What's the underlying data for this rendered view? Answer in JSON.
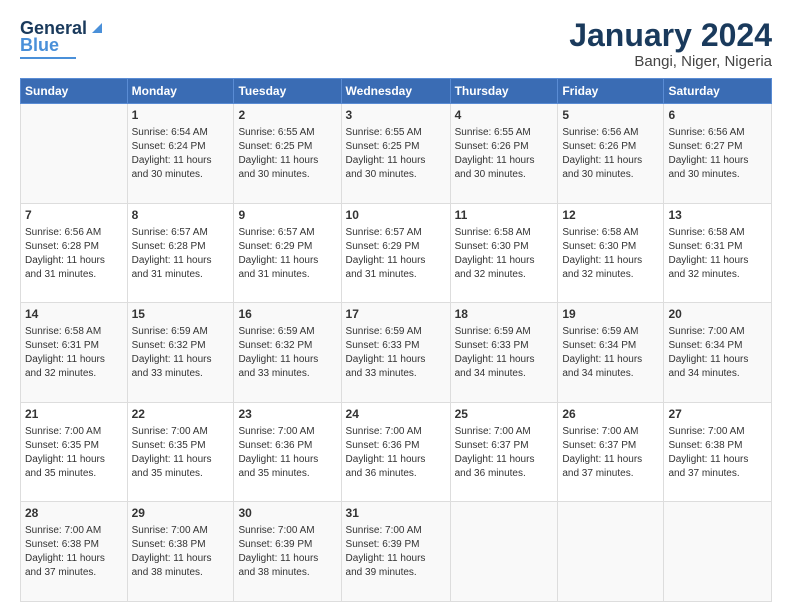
{
  "header": {
    "logo_line1": "General",
    "logo_line2": "Blue",
    "title": "January 2024",
    "subtitle": "Bangi, Niger, Nigeria"
  },
  "columns": [
    "Sunday",
    "Monday",
    "Tuesday",
    "Wednesday",
    "Thursday",
    "Friday",
    "Saturday"
  ],
  "weeks": [
    [
      {
        "day": "",
        "info": ""
      },
      {
        "day": "1",
        "info": "Sunrise: 6:54 AM\nSunset: 6:24 PM\nDaylight: 11 hours\nand 30 minutes."
      },
      {
        "day": "2",
        "info": "Sunrise: 6:55 AM\nSunset: 6:25 PM\nDaylight: 11 hours\nand 30 minutes."
      },
      {
        "day": "3",
        "info": "Sunrise: 6:55 AM\nSunset: 6:25 PM\nDaylight: 11 hours\nand 30 minutes."
      },
      {
        "day": "4",
        "info": "Sunrise: 6:55 AM\nSunset: 6:26 PM\nDaylight: 11 hours\nand 30 minutes."
      },
      {
        "day": "5",
        "info": "Sunrise: 6:56 AM\nSunset: 6:26 PM\nDaylight: 11 hours\nand 30 minutes."
      },
      {
        "day": "6",
        "info": "Sunrise: 6:56 AM\nSunset: 6:27 PM\nDaylight: 11 hours\nand 30 minutes."
      }
    ],
    [
      {
        "day": "7",
        "info": "Sunrise: 6:56 AM\nSunset: 6:28 PM\nDaylight: 11 hours\nand 31 minutes."
      },
      {
        "day": "8",
        "info": "Sunrise: 6:57 AM\nSunset: 6:28 PM\nDaylight: 11 hours\nand 31 minutes."
      },
      {
        "day": "9",
        "info": "Sunrise: 6:57 AM\nSunset: 6:29 PM\nDaylight: 11 hours\nand 31 minutes."
      },
      {
        "day": "10",
        "info": "Sunrise: 6:57 AM\nSunset: 6:29 PM\nDaylight: 11 hours\nand 31 minutes."
      },
      {
        "day": "11",
        "info": "Sunrise: 6:58 AM\nSunset: 6:30 PM\nDaylight: 11 hours\nand 32 minutes."
      },
      {
        "day": "12",
        "info": "Sunrise: 6:58 AM\nSunset: 6:30 PM\nDaylight: 11 hours\nand 32 minutes."
      },
      {
        "day": "13",
        "info": "Sunrise: 6:58 AM\nSunset: 6:31 PM\nDaylight: 11 hours\nand 32 minutes."
      }
    ],
    [
      {
        "day": "14",
        "info": "Sunrise: 6:58 AM\nSunset: 6:31 PM\nDaylight: 11 hours\nand 32 minutes."
      },
      {
        "day": "15",
        "info": "Sunrise: 6:59 AM\nSunset: 6:32 PM\nDaylight: 11 hours\nand 33 minutes."
      },
      {
        "day": "16",
        "info": "Sunrise: 6:59 AM\nSunset: 6:32 PM\nDaylight: 11 hours\nand 33 minutes."
      },
      {
        "day": "17",
        "info": "Sunrise: 6:59 AM\nSunset: 6:33 PM\nDaylight: 11 hours\nand 33 minutes."
      },
      {
        "day": "18",
        "info": "Sunrise: 6:59 AM\nSunset: 6:33 PM\nDaylight: 11 hours\nand 34 minutes."
      },
      {
        "day": "19",
        "info": "Sunrise: 6:59 AM\nSunset: 6:34 PM\nDaylight: 11 hours\nand 34 minutes."
      },
      {
        "day": "20",
        "info": "Sunrise: 7:00 AM\nSunset: 6:34 PM\nDaylight: 11 hours\nand 34 minutes."
      }
    ],
    [
      {
        "day": "21",
        "info": "Sunrise: 7:00 AM\nSunset: 6:35 PM\nDaylight: 11 hours\nand 35 minutes."
      },
      {
        "day": "22",
        "info": "Sunrise: 7:00 AM\nSunset: 6:35 PM\nDaylight: 11 hours\nand 35 minutes."
      },
      {
        "day": "23",
        "info": "Sunrise: 7:00 AM\nSunset: 6:36 PM\nDaylight: 11 hours\nand 35 minutes."
      },
      {
        "day": "24",
        "info": "Sunrise: 7:00 AM\nSunset: 6:36 PM\nDaylight: 11 hours\nand 36 minutes."
      },
      {
        "day": "25",
        "info": "Sunrise: 7:00 AM\nSunset: 6:37 PM\nDaylight: 11 hours\nand 36 minutes."
      },
      {
        "day": "26",
        "info": "Sunrise: 7:00 AM\nSunset: 6:37 PM\nDaylight: 11 hours\nand 37 minutes."
      },
      {
        "day": "27",
        "info": "Sunrise: 7:00 AM\nSunset: 6:38 PM\nDaylight: 11 hours\nand 37 minutes."
      }
    ],
    [
      {
        "day": "28",
        "info": "Sunrise: 7:00 AM\nSunset: 6:38 PM\nDaylight: 11 hours\nand 37 minutes."
      },
      {
        "day": "29",
        "info": "Sunrise: 7:00 AM\nSunset: 6:38 PM\nDaylight: 11 hours\nand 38 minutes."
      },
      {
        "day": "30",
        "info": "Sunrise: 7:00 AM\nSunset: 6:39 PM\nDaylight: 11 hours\nand 38 minutes."
      },
      {
        "day": "31",
        "info": "Sunrise: 7:00 AM\nSunset: 6:39 PM\nDaylight: 11 hours\nand 39 minutes."
      },
      {
        "day": "",
        "info": ""
      },
      {
        "day": "",
        "info": ""
      },
      {
        "day": "",
        "info": ""
      }
    ]
  ]
}
